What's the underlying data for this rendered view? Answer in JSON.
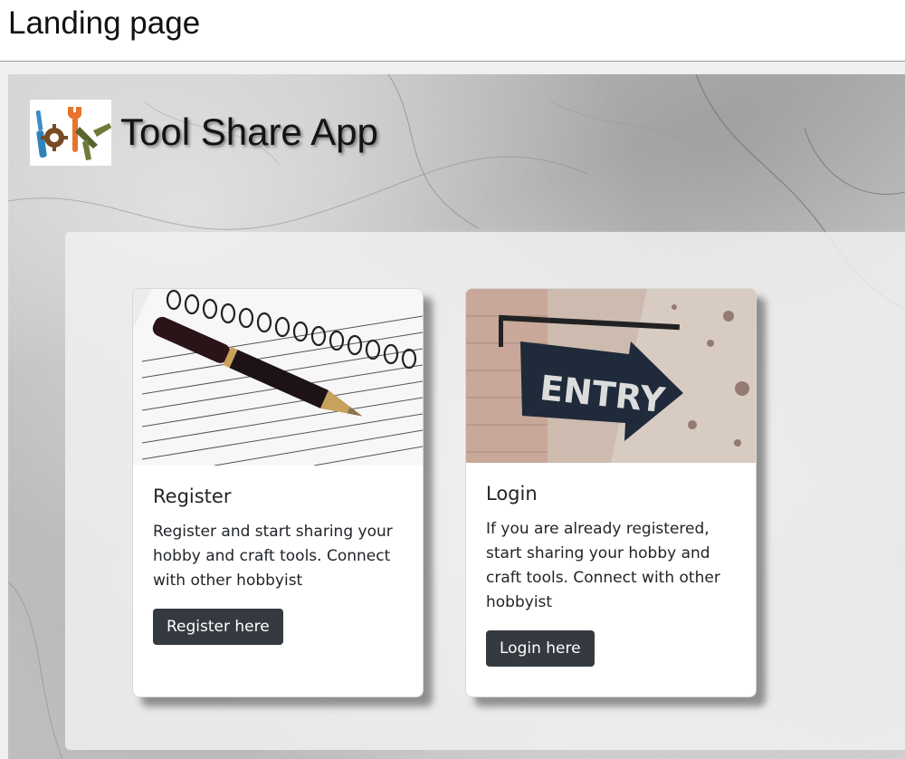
{
  "page": {
    "title": "Landing page"
  },
  "brand": {
    "title": "Tool Share App",
    "logo_icon": "diy-tools-logo-icon"
  },
  "cards": [
    {
      "image_icon": "pen-and-notebook-image",
      "title": "Register",
      "text": "Register and start sharing your hobby and craft tools. Connect with other hobbyist",
      "button_label": "Register here"
    },
    {
      "image_icon": "entry-sign-image",
      "image_text": "ENTRY",
      "title": "Login",
      "text": "If you are already registered, start sharing your hobby and craft tools. Connect with other hobbyist",
      "button_label": "Login here"
    }
  ],
  "colors": {
    "button_bg": "#343a40",
    "button_text": "#ffffff",
    "text": "#212529",
    "panel_bg": "#f0f0f0"
  }
}
